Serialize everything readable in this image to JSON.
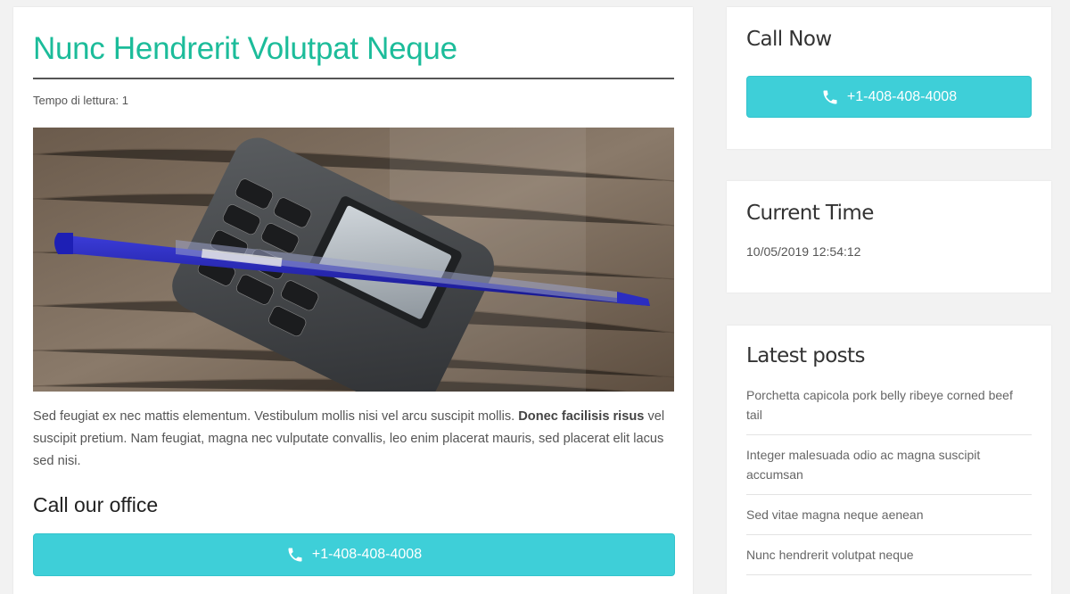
{
  "post": {
    "title": "Nunc Hendrerit Volutpat Neque",
    "reading_time": "Tempo di lettura: 1",
    "image_alt": "phone-and-pen-photo",
    "body_before": "Sed feugiat ex nec mattis elementum. Vestibulum mollis nisi vel arcu suscipit mollis. ",
    "body_bold": "Donec facilisis risus",
    "body_after": " vel suscipit pretium. Nam feugiat, magna nec vulputate convallis, leo enim placerat mauris, sed placerat elit lacus sed nisi.",
    "office_heading": "Call our office",
    "phone": "+1-408-408-4008"
  },
  "sidebar": {
    "call_now": {
      "title": "Call Now",
      "phone": "+1-408-408-4008"
    },
    "current_time": {
      "title": "Current Time",
      "value": "10/05/2019 12:54:12"
    },
    "latest_posts": {
      "title": "Latest posts",
      "items": [
        "Porchetta capicola pork belly ribeye corned beef tail",
        "Integer malesuada odio ac magna suscipit accumsan",
        "Sed vitae magna neque aenean",
        "Nunc hendrerit volutpat neque"
      ]
    }
  },
  "colors": {
    "accent": "#1cbc9a",
    "button": "#3ecfd8",
    "background": "#f2f2f2"
  },
  "icons": {
    "phone": "phone-icon"
  }
}
